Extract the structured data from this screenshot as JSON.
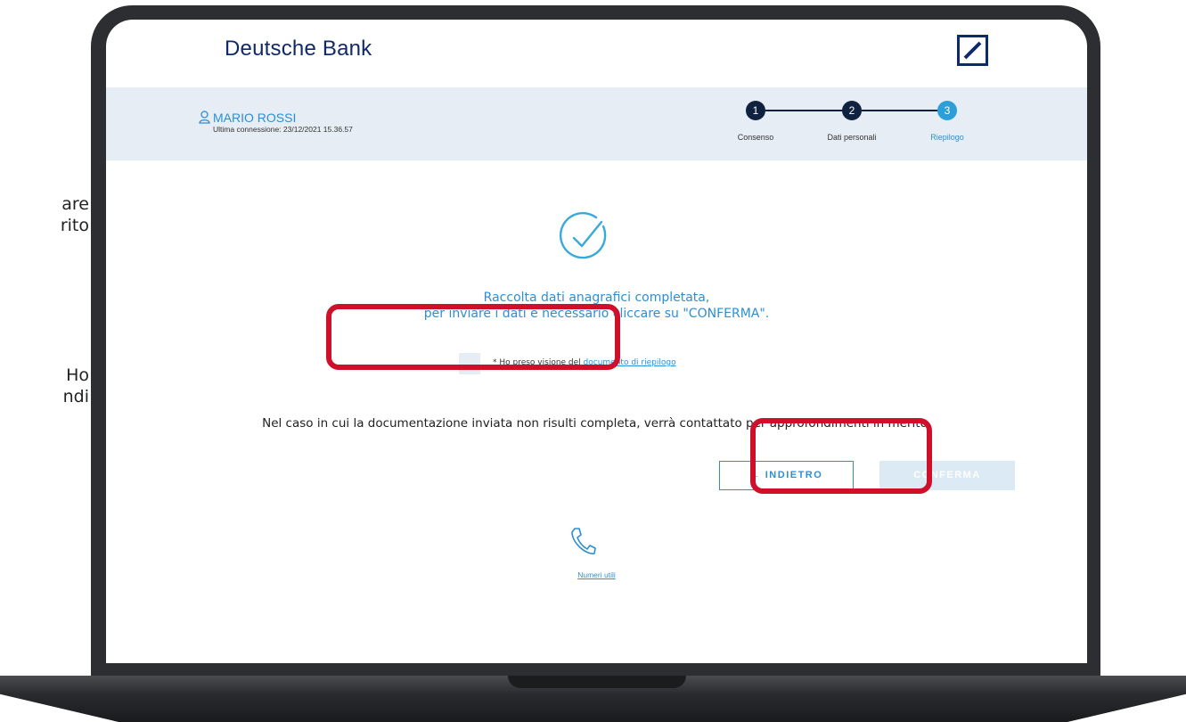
{
  "side_fragments": [
    "are",
    "rito",
    "Ho",
    "ndi"
  ],
  "header": {
    "brand": "Deutsche Bank",
    "logo_icon": "deutsche-bank-logo"
  },
  "user": {
    "name": "MARIO ROSSI",
    "last_connection": "Ultima connessione: 23/12/2021 15.36.57"
  },
  "steps": [
    {
      "number": "1",
      "label": "Consenso",
      "state": "done"
    },
    {
      "number": "2",
      "label": "Dati personali",
      "state": "done"
    },
    {
      "number": "3",
      "label": "Riepilogo",
      "state": "active"
    }
  ],
  "main": {
    "message_line1": "Raccolta dati anagrafici completata,",
    "message_line2": "per inviare i dati è necessario cliccare su \"CONFERMA\".",
    "consent_prefix": "* Ho preso visione del ",
    "consent_link": "documento di riepilogo",
    "note": "Nel caso in cui la documentazione inviata non risulti completa, verrà contattato per approfondimenti in merito.",
    "back_label": "← INDIETRO",
    "confirm_label": "CONFERMA",
    "useful_numbers": "Numeri utili"
  },
  "colors": {
    "brand_navy": "#0f2a6b",
    "accent_blue": "#2c8fd6",
    "step_done": "#0f2340",
    "highlight_red": "#d0102a",
    "band": "#e6edf4"
  }
}
